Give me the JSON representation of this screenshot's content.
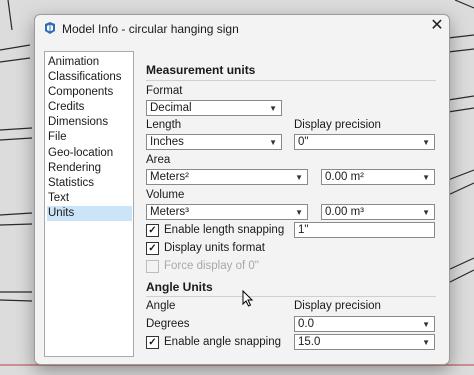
{
  "window": {
    "title": "Model Info - circular hanging sign",
    "close_glyph": "✕"
  },
  "sidebar": {
    "items": [
      {
        "label": "Animation"
      },
      {
        "label": "Classifications"
      },
      {
        "label": "Components"
      },
      {
        "label": "Credits"
      },
      {
        "label": "Dimensions"
      },
      {
        "label": "File"
      },
      {
        "label": "Geo-location"
      },
      {
        "label": "Rendering"
      },
      {
        "label": "Statistics"
      },
      {
        "label": "Text"
      },
      {
        "label": "Units",
        "selected": true
      }
    ]
  },
  "measurement": {
    "heading": "Measurement units",
    "format_label": "Format",
    "format_value": "Decimal",
    "length_label": "Length",
    "length_value": "Inches",
    "display_precision_label": "Display precision",
    "length_precision_value": "0\"",
    "area_label": "Area",
    "area_value": "Meters²",
    "area_precision_value": "0.00 m²",
    "volume_label": "Volume",
    "volume_value": "Meters³",
    "volume_precision_value": "0.00 m³",
    "length_snapping_label": "Enable length snapping",
    "length_snapping_checked": true,
    "length_snapping_value": "1\"",
    "display_units_label": "Display units format",
    "display_units_checked": true,
    "force_display_label": "Force display of 0\"",
    "force_display_checked": false,
    "force_display_enabled": false
  },
  "angle": {
    "heading": "Angle Units",
    "angle_label": "Angle",
    "display_precision_label": "Display precision",
    "degrees_label": "Degrees",
    "precision_value": "0.0",
    "angle_snapping_label": "Enable angle snapping",
    "angle_snapping_checked": true,
    "angle_snapping_value": "15.0"
  },
  "glyphs": {
    "check": "✓",
    "dropdown": "▼"
  },
  "colors": {
    "selection": "#cce4f7",
    "dialog_bg": "#f3f3f3",
    "icon_blue": "#2f6fb5"
  }
}
